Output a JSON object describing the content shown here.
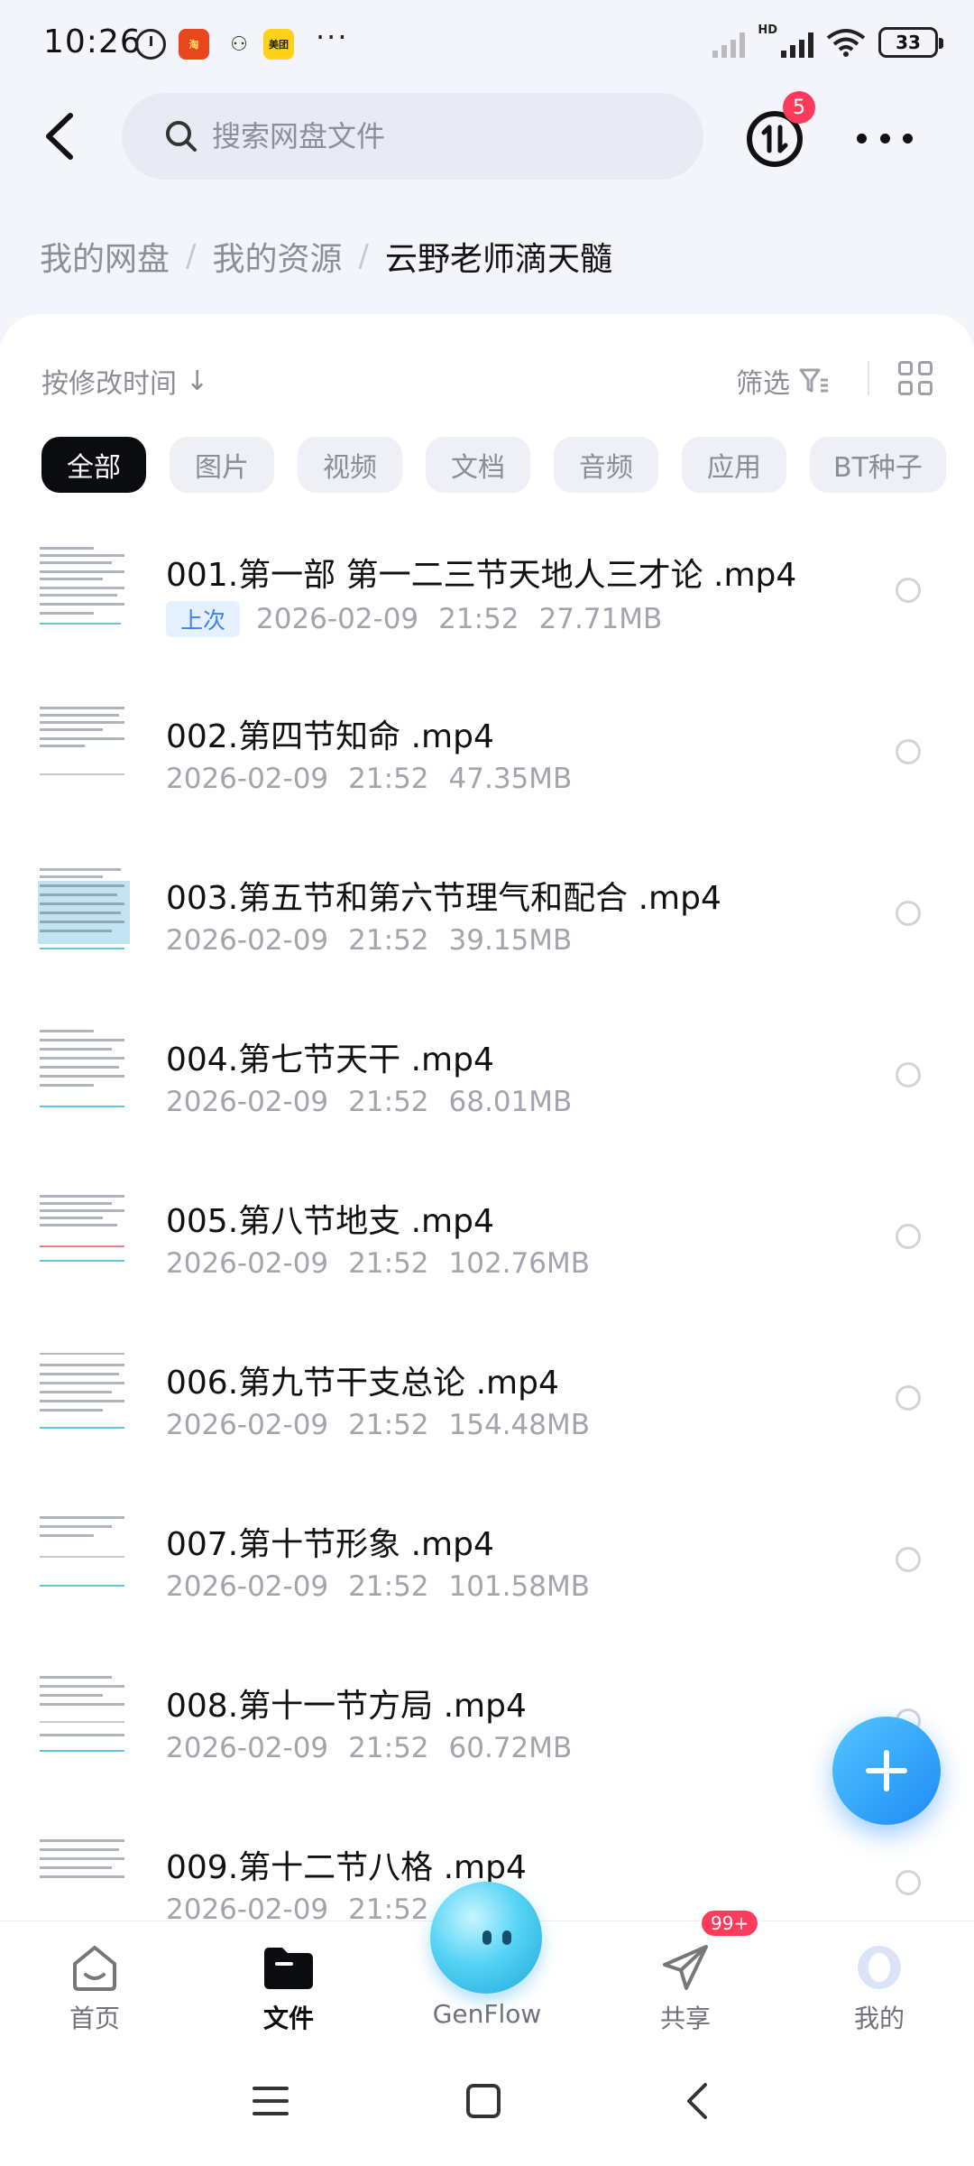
{
  "status_bar": {
    "time": "10:26",
    "taobao_label": "淘",
    "meituan_label": "美团",
    "more": "···",
    "hd_label": "HD",
    "battery": "33"
  },
  "header": {
    "search_placeholder": "搜索网盘文件",
    "transfer_badge": "5"
  },
  "breadcrumb": {
    "items": [
      "我的网盘",
      "我的资源"
    ],
    "separator": "/",
    "current": "云野老师滴天髓"
  },
  "toolbar": {
    "sort_label": "按修改时间",
    "sort_arrow": "↓",
    "filter_label": "筛选"
  },
  "chips": [
    "全部",
    "图片",
    "视频",
    "文档",
    "音频",
    "应用",
    "BT种子"
  ],
  "files": [
    {
      "name": "001.第一部 第一二三节天地人三才论 .mp4",
      "tag": "上次",
      "date": "2026-02-09",
      "time": "21:52",
      "size": "27.71MB"
    },
    {
      "name": "002.第四节知命 .mp4",
      "date": "2026-02-09",
      "time": "21:52",
      "size": "47.35MB"
    },
    {
      "name": "003.第五节和第六节理气和配合 .mp4",
      "date": "2026-02-09",
      "time": "21:52",
      "size": "39.15MB"
    },
    {
      "name": "004.第七节天干 .mp4",
      "date": "2026-02-09",
      "time": "21:52",
      "size": "68.01MB"
    },
    {
      "name": "005.第八节地支 .mp4",
      "date": "2026-02-09",
      "time": "21:52",
      "size": "102.76MB"
    },
    {
      "name": "006.第九节干支总论 .mp4",
      "date": "2026-02-09",
      "time": "21:52",
      "size": "154.48MB"
    },
    {
      "name": "007.第十节形象 .mp4",
      "date": "2026-02-09",
      "time": "21:52",
      "size": "101.58MB"
    },
    {
      "name": "008.第十一节方局 .mp4",
      "date": "2026-02-09",
      "time": "21:52",
      "size": "60.72MB"
    },
    {
      "name": "009.第十二节八格 .mp4",
      "date": "2026-02-09",
      "time": "21:52",
      "size": ""
    }
  ],
  "bottom_nav": {
    "home": "首页",
    "files": "文件",
    "genflow": "GenFlow",
    "share": "共享",
    "share_badge": "99+",
    "me": "我的"
  },
  "colors": {
    "accent": "#1e8bf5",
    "badge": "#ff3b5c",
    "active_chip": "#0b0c10"
  }
}
